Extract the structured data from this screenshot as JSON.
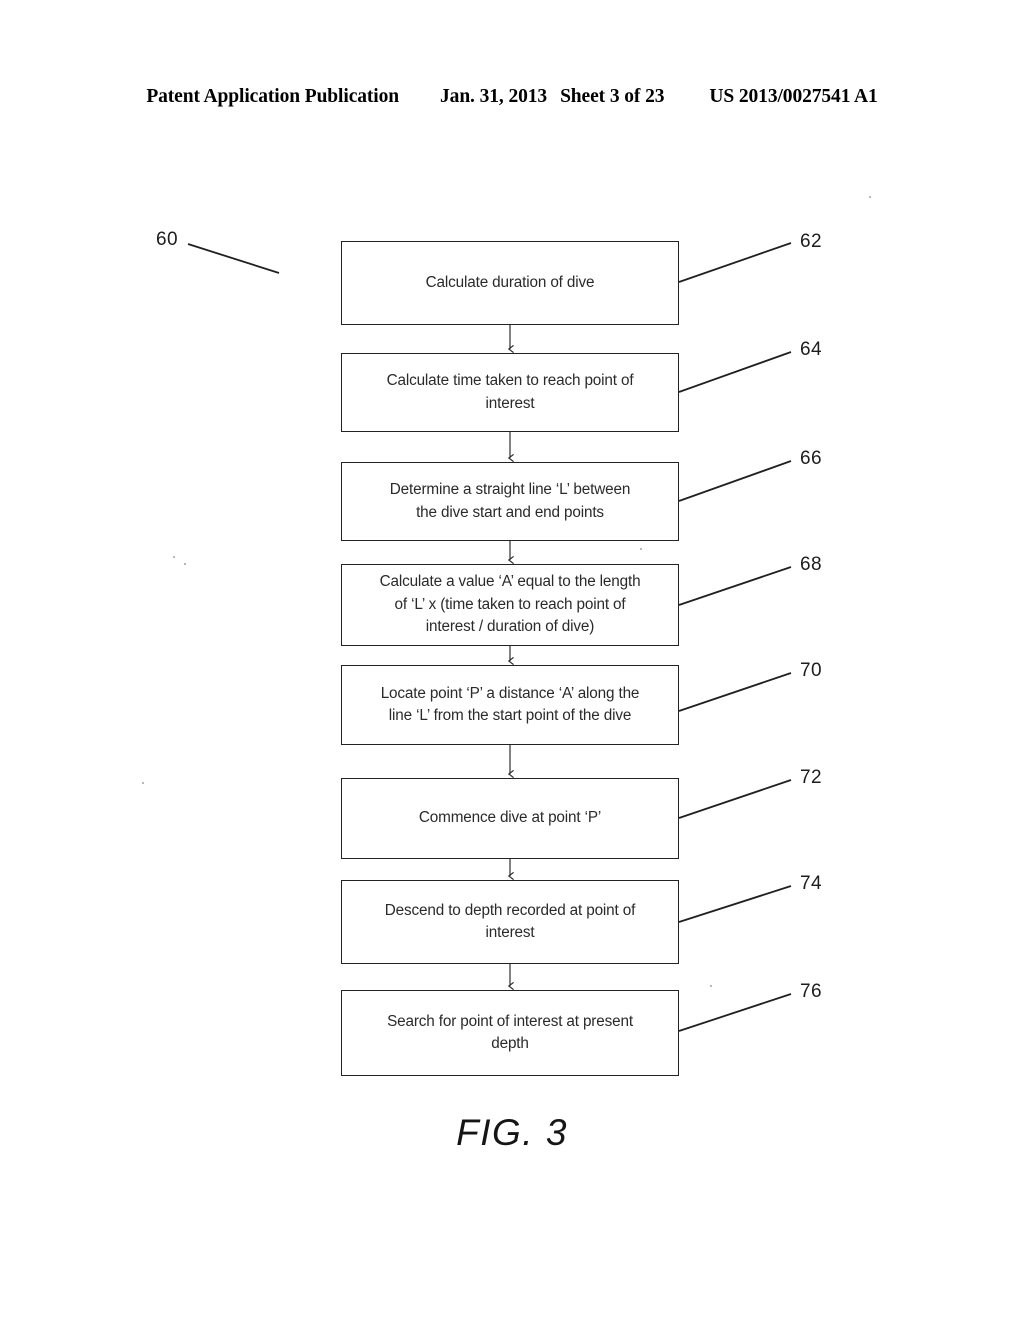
{
  "header": {
    "publication": "Patent Application Publication",
    "date": "Jan. 31, 2013",
    "sheet": "Sheet 3 of 23",
    "patent_number": "US 2013/0027541 A1"
  },
  "figure": {
    "caption": "FIG. 3",
    "diagram_ref": "60"
  },
  "flowchart": {
    "steps": [
      {
        "ref": "62",
        "text": "Calculate duration of dive"
      },
      {
        "ref": "64",
        "text": "Calculate time taken to reach point of\ninterest"
      },
      {
        "ref": "66",
        "text": "Determine a straight line ‘L’ between\nthe dive start and end points"
      },
      {
        "ref": "68",
        "text": "Calculate a value ‘A’ equal to the length\nof ‘L’ x (time taken to reach point of\ninterest / duration of dive)"
      },
      {
        "ref": "70",
        "text": "Locate point ‘P’ a distance ‘A’ along the\nline ‘L’ from the start point of the dive"
      },
      {
        "ref": "72",
        "text": "Commence dive at point ‘P’"
      },
      {
        "ref": "74",
        "text": "Descend to depth recorded at point of\ninterest"
      },
      {
        "ref": "76",
        "text": "Search for point of interest at present\ndepth"
      }
    ]
  }
}
